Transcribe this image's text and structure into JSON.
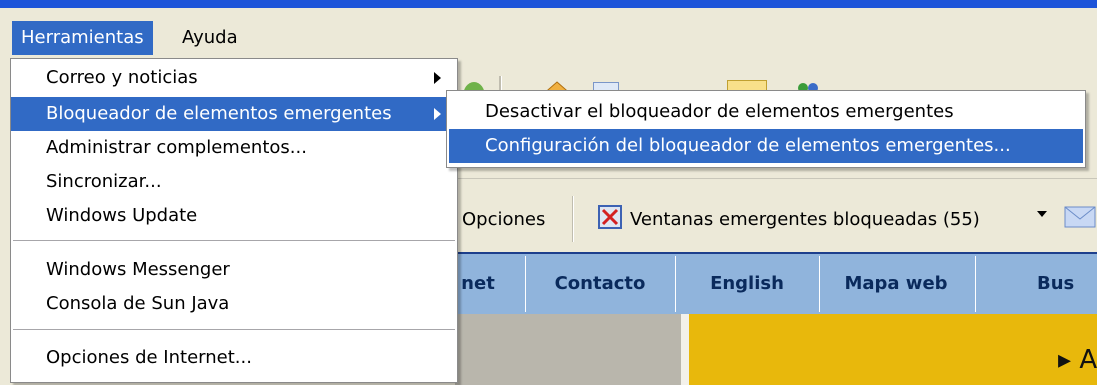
{
  "menubar": {
    "items": [
      {
        "label": "Herramientas",
        "active": true
      },
      {
        "label": "Ayuda",
        "active": false
      }
    ]
  },
  "tools_menu": {
    "items": [
      {
        "label": "Correo y noticias",
        "submenu": true
      },
      {
        "label": "Bloqueador de elementos emergentes",
        "submenu": true,
        "selected": true
      },
      {
        "label": "Administrar complementos..."
      },
      {
        "label": "Sincronizar..."
      },
      {
        "label": "Windows Update"
      },
      {
        "label": "Windows Messenger"
      },
      {
        "label": "Consola de Sun Java"
      },
      {
        "label": "Opciones de Internet..."
      }
    ]
  },
  "popup_submenu": {
    "items": [
      {
        "label": "Desactivar el bloqueador de elementos emergentes"
      },
      {
        "label": "Configuración del bloqueador de elementos emergentes...",
        "selected": true
      }
    ]
  },
  "toolbar": {
    "options_label": "Opciones",
    "blocked_popups_label": "Ventanas emergentes bloqueadas (55)"
  },
  "site_nav": {
    "items": [
      "net",
      "Contacto",
      "English",
      "Mapa web",
      "Bus"
    ]
  },
  "promo_text": "▸ A",
  "colors": {
    "menu_highlight": "#316ac5",
    "nav_bar": "#90b4dc",
    "banner": "#e8b80c"
  }
}
